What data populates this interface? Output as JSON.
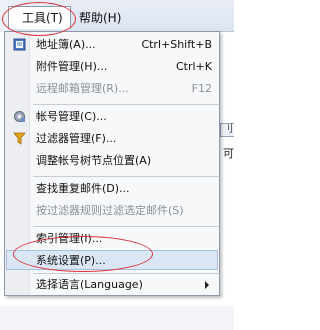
{
  "menubar": {
    "tools_label": "工具(T)",
    "help_label": "帮助(H)"
  },
  "background": {
    "tab_text": "刂",
    "side_text": "可"
  },
  "tools_menu": {
    "items": [
      {
        "label": "地址簿(A)...",
        "shortcut": "Ctrl+Shift+B",
        "icon": "address-book-icon",
        "disabled": false
      },
      {
        "label": "附件管理(H)...",
        "shortcut": "Ctrl+K",
        "disabled": false
      },
      {
        "label": "远程邮箱管理(R)...",
        "shortcut": "F12",
        "disabled": true
      },
      {
        "label": "帐号管理(C)...",
        "icon": "account-settings-icon",
        "disabled": false
      },
      {
        "label": "过滤器管理(F)...",
        "icon": "filter-icon",
        "disabled": false
      },
      {
        "label": "调整帐号树节点位置(A)",
        "disabled": false
      },
      {
        "label": "查找重复邮件(D)...",
        "disabled": false
      },
      {
        "label": "按过滤器规则过滤选定邮件(S)",
        "disabled": true
      },
      {
        "label": "索引管理(I)...",
        "disabled": false
      },
      {
        "label": "系统设置(P)...",
        "disabled": false,
        "selected": true
      },
      {
        "label": "选择语言(Language)",
        "disabled": false,
        "has_submenu": true
      }
    ]
  },
  "annotation_color": "#d9323a"
}
